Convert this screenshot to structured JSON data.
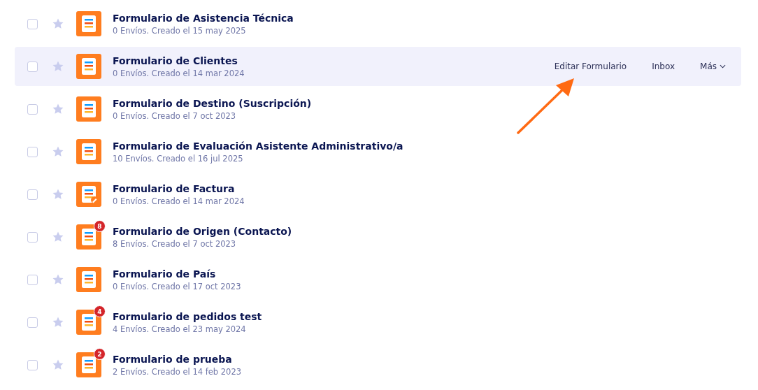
{
  "forms": [
    {
      "title": "Formulario de Asistencia Técnica",
      "meta": "0 Envíos. Creado el 15 may 2025",
      "kind": "form",
      "hovered": false,
      "checked": false
    },
    {
      "title": "Formulario de Clientes",
      "meta": "0 Envíos. Creado el 14 mar 2024",
      "kind": "form",
      "hovered": true,
      "checked": false,
      "actions": [
        {
          "label": "Editar Formulario",
          "kind": "link"
        },
        {
          "label": "Inbox",
          "kind": "link"
        },
        {
          "label": "Más",
          "kind": "menu"
        }
      ]
    },
    {
      "title": "Formulario de Destino (Suscripción)",
      "meta": "0 Envíos. Creado el 7 oct 2023",
      "kind": "form",
      "hovered": false,
      "checked": false
    },
    {
      "title": "Formulario de Evaluación Asistente Administrativo/a",
      "meta": "10 Envíos. Creado el 16 jul 2025",
      "kind": "form",
      "hovered": false,
      "checked": false
    },
    {
      "title": "Formulario de Factura",
      "meta": "0 Envíos. Creado el 14 mar 2024",
      "kind": "signed",
      "hovered": false,
      "checked": false
    },
    {
      "title": "Formulario de Origen (Contacto)",
      "meta": "8 Envíos. Creado el 7 oct 2023",
      "kind": "form",
      "hovered": false,
      "checked": false,
      "badge": "8"
    },
    {
      "title": "Formulario de País",
      "meta": "0 Envíos. Creado el 17 oct 2023",
      "kind": "form",
      "hovered": false,
      "checked": false
    },
    {
      "title": "Formulario de pedidos test",
      "meta": "4 Envíos. Creado el 23 may 2024",
      "kind": "form",
      "hovered": false,
      "checked": false,
      "badge": "4"
    },
    {
      "title": "Formulario de prueba",
      "meta": "2 Envíos. Creado el 14 feb 2023",
      "kind": "form",
      "hovered": false,
      "checked": false,
      "badge": "2"
    }
  ]
}
